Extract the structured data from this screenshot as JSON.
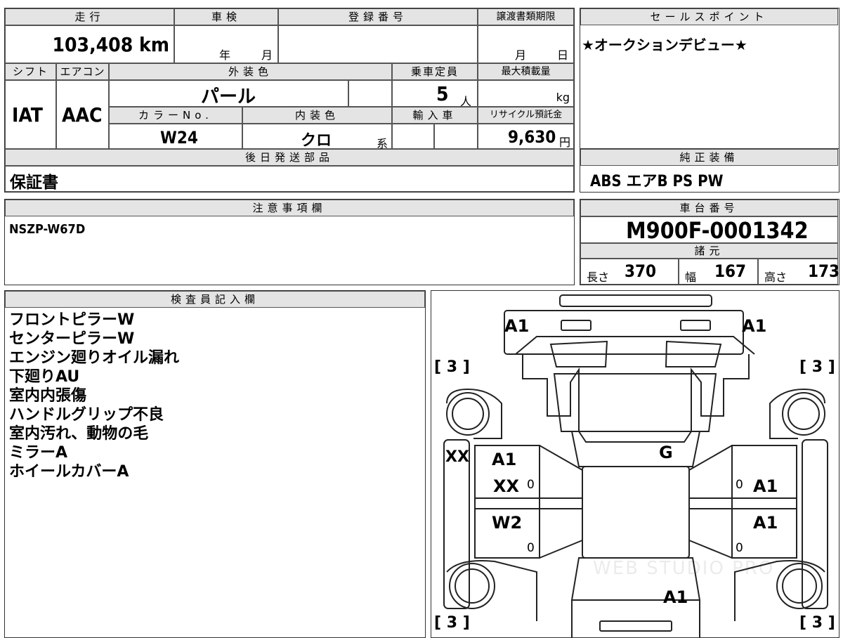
{
  "top_table": {
    "h_mileage": "走行",
    "h_shaken": "車検",
    "h_reg": "登録番号",
    "h_transfer": "譲渡書類期限",
    "mileage": "103,408 km",
    "shaken_year": "年",
    "shaken_month": "月",
    "transfer_month": "月",
    "transfer_day": "日",
    "h_shift": "シフト",
    "h_ac": "エアコン",
    "h_ext_color": "外装色",
    "h_capacity": "乗車定員",
    "h_max_load": "最大積載量",
    "shift": "IAT",
    "ac": "AAC",
    "ext_color": "パール",
    "capacity": "5",
    "capacity_unit": "人",
    "load_unit": "kg",
    "h_color_no": "カラーNo.",
    "h_int_color": "内装色",
    "h_import": "輸入車",
    "h_recycle": "リサイクル預託金",
    "color_no": "W24",
    "int_color": "クロ",
    "int_suffix": "系",
    "recycle": "9,630",
    "recycle_unit": "円",
    "h_later": "後日発送部品",
    "later": "保証書"
  },
  "sales": {
    "header": "セールスポイント",
    "text": "★オークションデビュー★"
  },
  "genuine": {
    "header": "純正装備",
    "text": "ABS エアB PS PW"
  },
  "notes": {
    "header": "注意事項欄",
    "text": "NSZP-W67D"
  },
  "chassis": {
    "header": "車台番号",
    "number": "M900F-0001342",
    "spec_header": "諸元",
    "length_label": "長さ",
    "length": "370",
    "width_label": "幅",
    "width": "167",
    "height_label": "高さ",
    "height": "173"
  },
  "inspector": {
    "header": "検査員記入欄",
    "lines": [
      "フロントピラーW",
      "センターピラーW",
      "エンジン廻りオイル漏れ",
      "下廻りAU",
      "室内内張傷",
      "ハンドルグリップ不良",
      "室内汚れ、動物の毛",
      "ミラーA",
      "ホイールカバーA"
    ]
  },
  "diagram": {
    "front_left": "A1",
    "front_right": "A1",
    "tire_fl": "3",
    "tire_fr": "3",
    "tire_rl": "3",
    "tire_rr": "3",
    "side_left": "XX",
    "door_fl_1": "A1",
    "door_fl_2": "XX",
    "door_rl": "W2",
    "glass": "G",
    "door_fr": "A1",
    "door_rr": "A1",
    "rear": "A1",
    "zero": "0",
    "watermark": "WEB STUDIO PRO"
  }
}
